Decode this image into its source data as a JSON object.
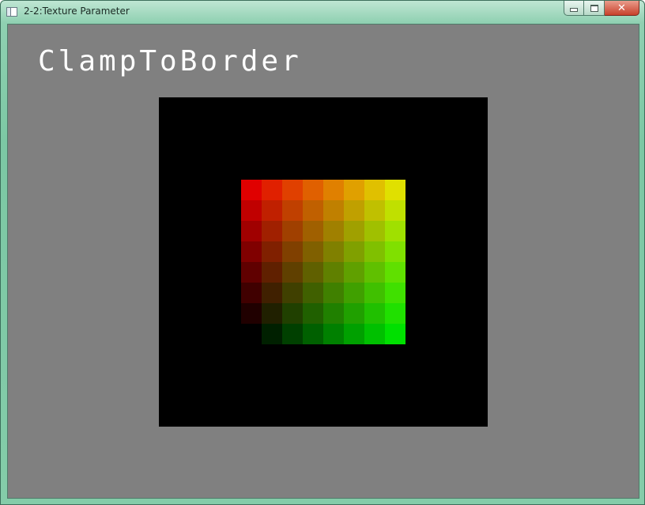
{
  "window": {
    "title": "2-2:Texture Parameter",
    "controls": {
      "minimize": "minimize-icon",
      "maximize": "maximize-icon",
      "close": "close-icon"
    },
    "close_glyph": "✕"
  },
  "scene": {
    "caption": "ClampToBorder",
    "background_color": "#808080",
    "border_color": "#000000",
    "texture": {
      "size": 8,
      "red_channel": "decreases downward",
      "green_channel": "increases rightward",
      "colors": [
        [
          "#e00000",
          "#e02000",
          "#e04000",
          "#e06000",
          "#e08000",
          "#e0a000",
          "#e0c000",
          "#e0e000"
        ],
        [
          "#c00000",
          "#c02000",
          "#c04000",
          "#c06000",
          "#c08000",
          "#c0a000",
          "#c0c000",
          "#c0e000"
        ],
        [
          "#a00000",
          "#a02000",
          "#a04000",
          "#a06000",
          "#a08000",
          "#a0a000",
          "#a0c000",
          "#a0e000"
        ],
        [
          "#800000",
          "#802000",
          "#804000",
          "#806000",
          "#808000",
          "#80a000",
          "#80c000",
          "#80e000"
        ],
        [
          "#600000",
          "#602000",
          "#604000",
          "#606000",
          "#608000",
          "#60a000",
          "#60c000",
          "#60e000"
        ],
        [
          "#400000",
          "#402000",
          "#404000",
          "#406000",
          "#408000",
          "#40a000",
          "#40c000",
          "#40e000"
        ],
        [
          "#200000",
          "#202000",
          "#204000",
          "#206000",
          "#208000",
          "#20a000",
          "#20c000",
          "#20e000"
        ],
        [
          "#000000",
          "#002000",
          "#004000",
          "#006000",
          "#008000",
          "#00a000",
          "#00c000",
          "#00e000"
        ]
      ]
    }
  }
}
